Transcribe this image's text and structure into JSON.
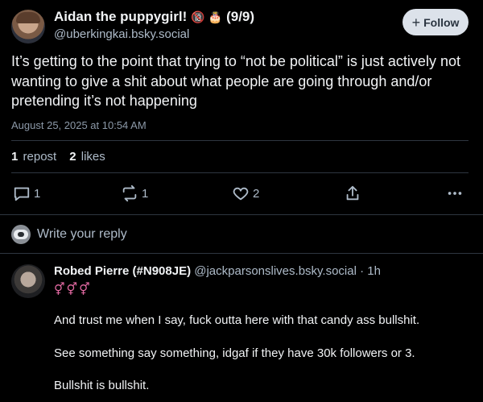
{
  "post": {
    "author_name": "Aidan the puppygirl!",
    "author_emoji": "🔞 🎂",
    "author_suffix": "(9/9)",
    "handle": "@uberkingkai.bsky.social",
    "follow_label": "Follow",
    "text": "It’s getting to the point that trying to “not be political” is just actively not wanting to give a shit about what people are going through and/or pretending it’s not happening",
    "timestamp": "August 25, 2025 at 10:54 AM",
    "stats": {
      "reposts_count": "1",
      "reposts_label": "repost",
      "likes_count": "2",
      "likes_label": "likes"
    },
    "actions": {
      "replies": "1",
      "reposts": "1",
      "likes": "2"
    }
  },
  "reply_box": {
    "placeholder": "Write your reply"
  },
  "comment": {
    "author_name": "Robed Pierre (#N908JE)",
    "handle": "@jackparsonslives.bsky.social",
    "separator": "·",
    "age": "1h",
    "badges": "⚥⚥⚥",
    "lines": [
      "And trust me when I say, fuck outta here with that candy ass bullshit.",
      "See something say something, idgaf if they have 30k followers or 3.",
      "Bullshit is bullshit."
    ]
  },
  "icons": {
    "follow": "plus-icon",
    "reply": "reply-bubble-icon",
    "repost": "repost-icon",
    "like": "heart-icon",
    "share": "share-icon",
    "more": "more-dots-icon"
  },
  "colors": {
    "background": "#000000",
    "text": "#f1f3f5",
    "secondary_text": "#aebbc9",
    "follow_button_bg": "#dce2ea",
    "divider": "#2e3640"
  }
}
